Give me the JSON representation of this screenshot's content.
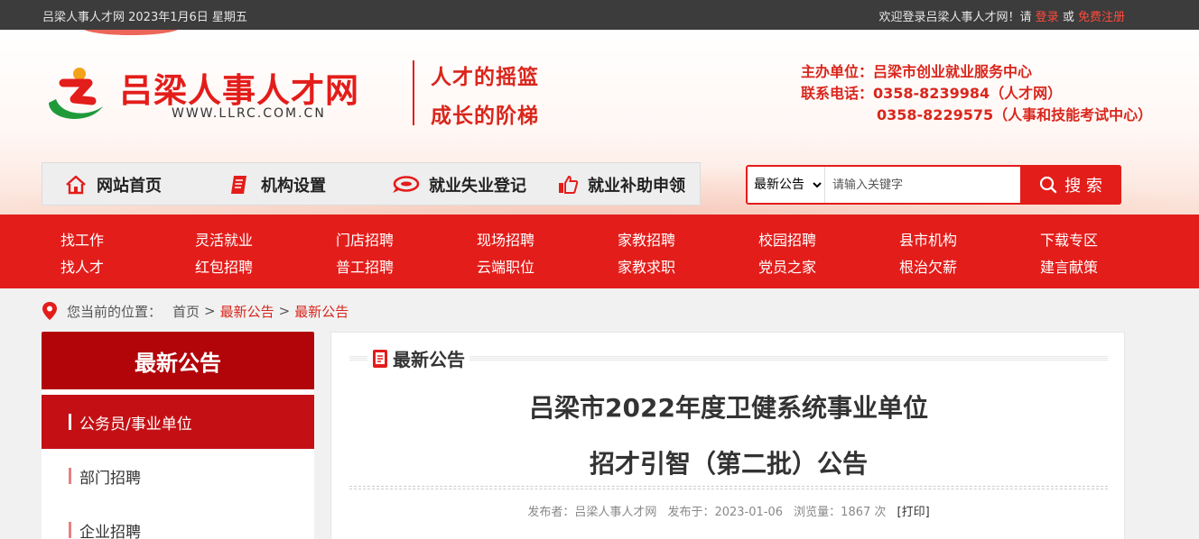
{
  "topbar": {
    "date_text": "吕梁人事人才网 2023年1月6日 星期五",
    "welcome": "欢迎登录吕梁人事人才网！请",
    "login": "登录",
    "or": "或",
    "register": "免费注册"
  },
  "header": {
    "site_name": "吕梁人事人才网",
    "site_url": "WWW.LLRC.COM.CN",
    "slogan_1": "人才的摇篮",
    "slogan_2": "成长的阶梯",
    "contact_line_1": "主办单位：吕梁市创业就业服务中心",
    "contact_line_2": "联系电话：0358-8239984（人才网）",
    "contact_line_3": "0358-8229575（人事和技能考试中心）"
  },
  "mainnav": {
    "items": [
      {
        "label": "网站首页",
        "icon": "house-icon"
      },
      {
        "label": "机构设置",
        "icon": "document-icon"
      },
      {
        "label": "就业失业登记",
        "icon": "speech-bubble-icon"
      },
      {
        "label": "就业补助申领",
        "icon": "thumbs-up-icon"
      }
    ]
  },
  "search": {
    "selected_option": "最新公告",
    "placeholder": "请输入关键字",
    "button_label": "搜 索"
  },
  "categories": {
    "row1": [
      "找工作",
      "灵活就业",
      "门店招聘",
      "现场招聘",
      "家教招聘",
      "校园招聘",
      "县市机构",
      "下载专区"
    ],
    "row2": [
      "找人才",
      "红包招聘",
      "普工招聘",
      "云端职位",
      "家教求职",
      "党员之家",
      "根治欠薪",
      "建言献策"
    ]
  },
  "breadcrumb": {
    "prefix": "您当前的位置：",
    "home": "首页",
    "sep": ">",
    "level1": "最新公告",
    "level2": "最新公告"
  },
  "sidebar": {
    "title": "最新公告",
    "items": [
      "公务员/事业单位",
      "部门招聘",
      "企业招聘"
    ]
  },
  "article": {
    "section_label": "最新公告",
    "title_line_1": "吕梁市2022年度卫健系统事业单位",
    "title_line_2": "招才引智（第二批）公告",
    "publisher": "发布者：吕梁人事人才网",
    "published": "发布于：2023-01-06",
    "views": "浏览量：1867 次",
    "print": "[打印]"
  },
  "colors": {
    "brand_red": "#e31d1a",
    "sidebar_header": "#b2050a",
    "sidebar_active": "#c41015",
    "topbar_bg": "#3c3c3c"
  }
}
